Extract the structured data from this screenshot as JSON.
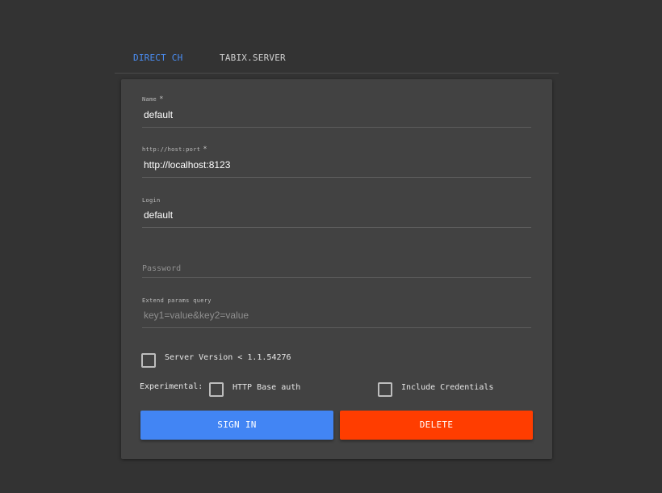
{
  "tabs": [
    {
      "label": "DIRECT CH",
      "active": true
    },
    {
      "label": "TABIX.SERVER",
      "active": false
    }
  ],
  "form": {
    "name": {
      "label": "Name",
      "required_mark": "*",
      "value": "default"
    },
    "host": {
      "label": "http://host:port",
      "required_mark": "*",
      "value": "http://localhost:8123"
    },
    "login": {
      "label": "Login",
      "value": "default"
    },
    "password": {
      "placeholder": "Password"
    },
    "params": {
      "label": "Extend params query",
      "placeholder": "key1=value&key2=value"
    }
  },
  "options": {
    "server_version_label": "Server Version < 1.1.54276",
    "experimental_label": "Experimental:",
    "http_base_auth_label": "HTTP Base auth",
    "include_credentials_label": "Include Credentials"
  },
  "buttons": {
    "sign_in": "SIGN IN",
    "delete": "DELETE"
  },
  "colors": {
    "background": "#333333",
    "card": "#424242",
    "accent": "#4285f4",
    "danger": "#ff3d00",
    "active_tab": "#4a8ef5"
  }
}
